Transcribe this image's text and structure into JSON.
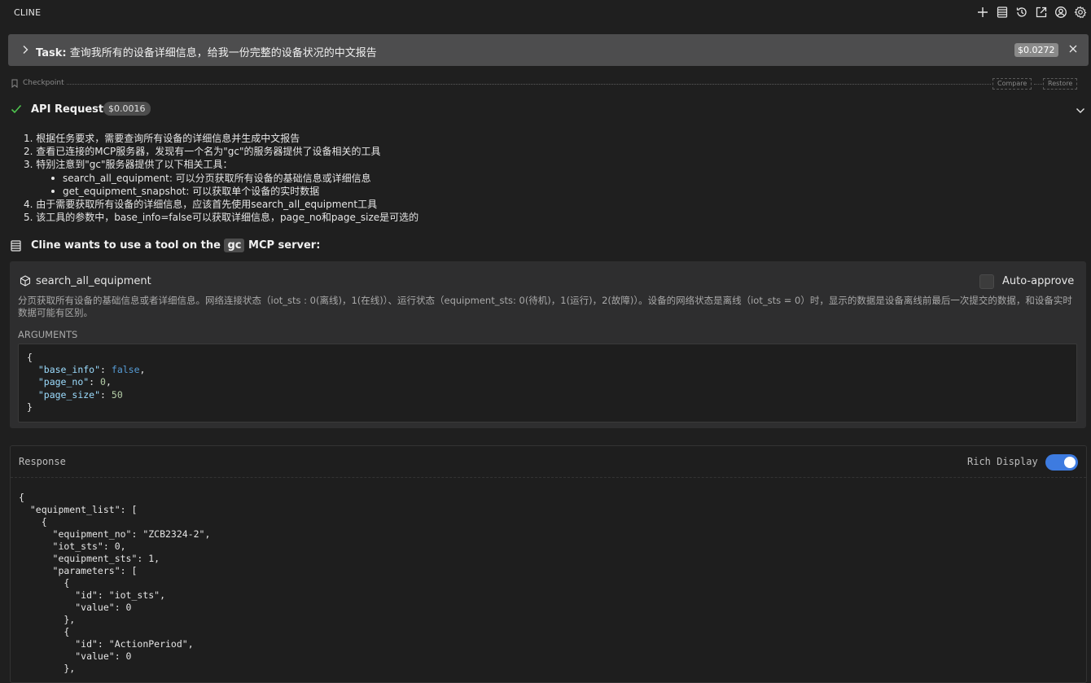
{
  "app": {
    "title": "CLINE"
  },
  "toolbar_icons": [
    "plus-icon",
    "server-icon",
    "history-icon",
    "external-link-icon",
    "account-icon",
    "settings-icon"
  ],
  "task": {
    "label": "Task:",
    "text": "查询我所有的设备详细信息，给我一份完整的设备状况的中文报告",
    "cost": "$0.0272"
  },
  "checkpoint": {
    "label": "Checkpoint",
    "compare": "Compare",
    "restore": "Restore"
  },
  "api_request": {
    "label": "API Request",
    "cost": "$0.0016"
  },
  "reasoning": {
    "items": [
      "1. 根据任务要求，需要查询所有设备的详细信息并生成中文报告",
      "2. 查看已连接的MCP服务器，发现有一个名为\"gc\"的服务器提供了设备相关的工具",
      "3. 特别注意到\"gc\"服务器提供了以下相关工具："
    ],
    "subitems": [
      "search_all_equipment: 可以分页获取所有设备的基础信息或详细信息",
      "get_equipment_snapshot: 可以获取单个设备的实时数据"
    ],
    "items2": [
      "4. 由于需要获取所有设备的详细信息，应该首先使用search_all_equipment工具",
      "5. 该工具的参数中，base_info=false可以获取详细信息，page_no和page_size是可选的"
    ]
  },
  "tool_use": {
    "prefix": "Cline wants to use a tool on the",
    "server": "gc",
    "suffix": "MCP server:",
    "tool_name": "search_all_equipment",
    "auto_approve": "Auto-approve",
    "auto_approve_checked": false,
    "description": "分页获取所有设备的基础信息或者详细信息。网络连接状态（iot_sts : 0(离线)，1(在线)）、运行状态（equipment_sts: 0(待机)，1(运行)，2(故障)）。设备的网络状态是离线（iot_sts = 0）时，显示的数据是设备离线前最后一次提交的数据，和设备实时数据可能有区别。",
    "arguments_label": "ARGUMENTS",
    "arguments": {
      "base_info": "false",
      "page_no": "0",
      "page_size": "50"
    }
  },
  "response": {
    "label": "Response",
    "rich_display_label": "Rich Display",
    "rich_display_on": true,
    "lines": [
      "{",
      "  \"equipment_list\": [",
      "    {",
      "      \"equipment_no\": \"ZCB2324-2\",",
      "      \"iot_sts\": 0,",
      "      \"equipment_sts\": 1,",
      "      \"parameters\": [",
      "        {",
      "          \"id\": \"iot_sts\",",
      "          \"value\": 0",
      "        },",
      "        {",
      "          \"id\": \"ActionPeriod\",",
      "          \"value\": 0",
      "        },"
    ]
  },
  "colors": {
    "accent": "#3d7be0",
    "check": "#4ec44e",
    "task_bar": "#4d4d4e"
  }
}
